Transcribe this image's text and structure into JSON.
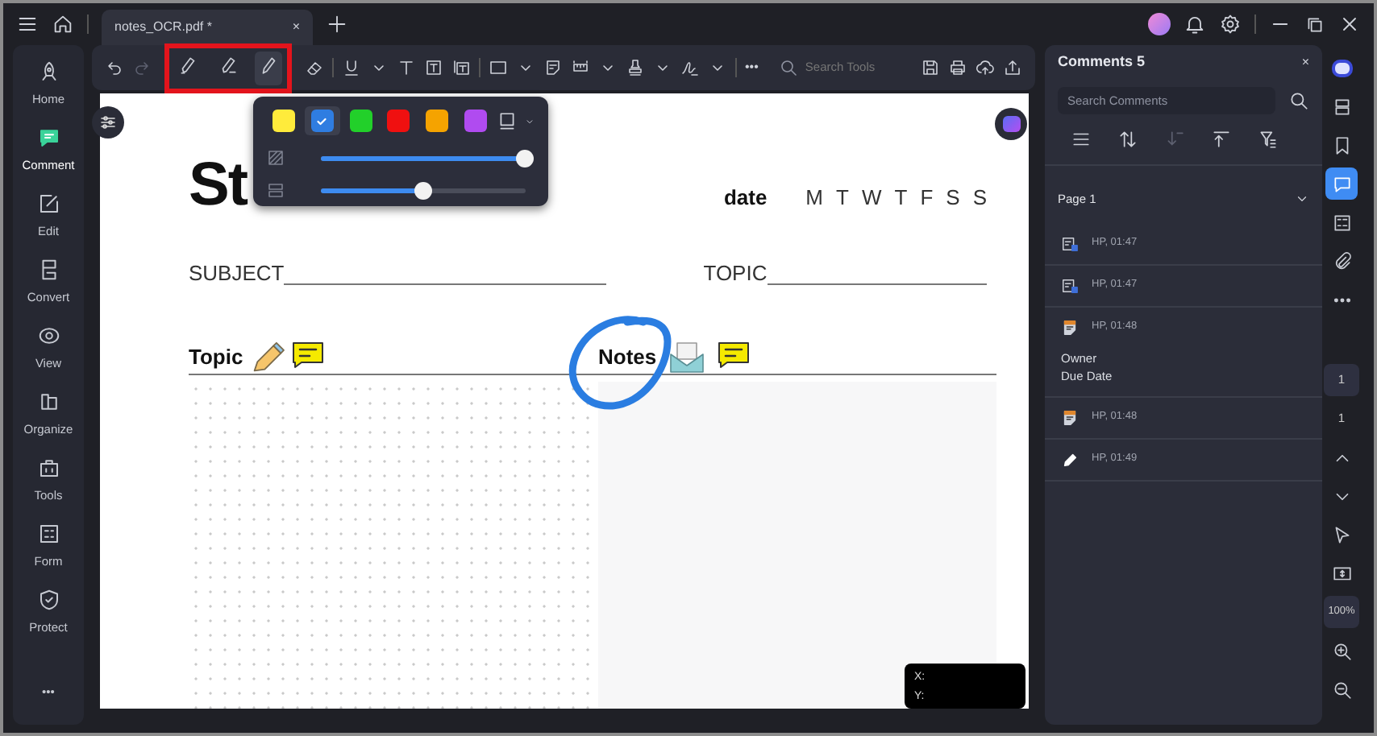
{
  "tab": {
    "title": "notes_OCR.pdf *",
    "close": "×"
  },
  "sidebar": {
    "items": [
      {
        "label": "Home",
        "selected": false
      },
      {
        "label": "Comment",
        "selected": true
      },
      {
        "label": "Edit",
        "selected": false
      },
      {
        "label": "Convert",
        "selected": false
      },
      {
        "label": "View",
        "selected": false
      },
      {
        "label": "Organize",
        "selected": false
      },
      {
        "label": "Tools",
        "selected": false
      },
      {
        "label": "Form",
        "selected": false
      },
      {
        "label": "Protect",
        "selected": false
      }
    ],
    "more": "•••"
  },
  "toolbar": {
    "highlight_tools": [
      {
        "selected": false
      },
      {
        "selected": false
      },
      {
        "selected": true
      }
    ],
    "more": "•••",
    "search": {
      "placeholder": "Search Tools"
    }
  },
  "color_popup": {
    "colors": [
      {
        "color": "#ffeb3b",
        "selected": false
      },
      {
        "color": "#2f7de1",
        "selected": true
      },
      {
        "color": "#22d02a",
        "selected": false
      },
      {
        "color": "#f01010",
        "selected": false
      },
      {
        "color": "#f5a300",
        "selected": false
      },
      {
        "color": "#b04bf0",
        "selected": false
      }
    ],
    "sliders": [
      {
        "level": 1.0
      },
      {
        "level": 0.5
      }
    ]
  },
  "document": {
    "heading": "St",
    "date_label": "date",
    "days": [
      "M",
      "T",
      "W",
      "T",
      "F",
      "S",
      "S"
    ],
    "subject": "SUBJECT",
    "topic": "TOPIC",
    "sections": [
      "Topic",
      "Notes"
    ],
    "coords": [
      "X:",
      "Y:"
    ]
  },
  "comments": {
    "title": "Comments 5",
    "close": "×",
    "search": {
      "placeholder": "Search Comments"
    },
    "page": "Page 1",
    "items": [
      {
        "kind": "textbox",
        "meta": "HP, 01:47"
      },
      {
        "kind": "textbox",
        "meta": "HP, 01:47"
      },
      {
        "kind": "note",
        "meta": "HP, 01:48",
        "lines": [
          "Owner",
          "Due Date"
        ]
      },
      {
        "kind": "note",
        "meta": "HP, 01:48"
      },
      {
        "kind": "pencil",
        "meta": "HP, 01:49"
      }
    ]
  },
  "rail": {
    "chat_selected": true,
    "page_input": "1",
    "page_total": "1",
    "zoom": "100%"
  }
}
